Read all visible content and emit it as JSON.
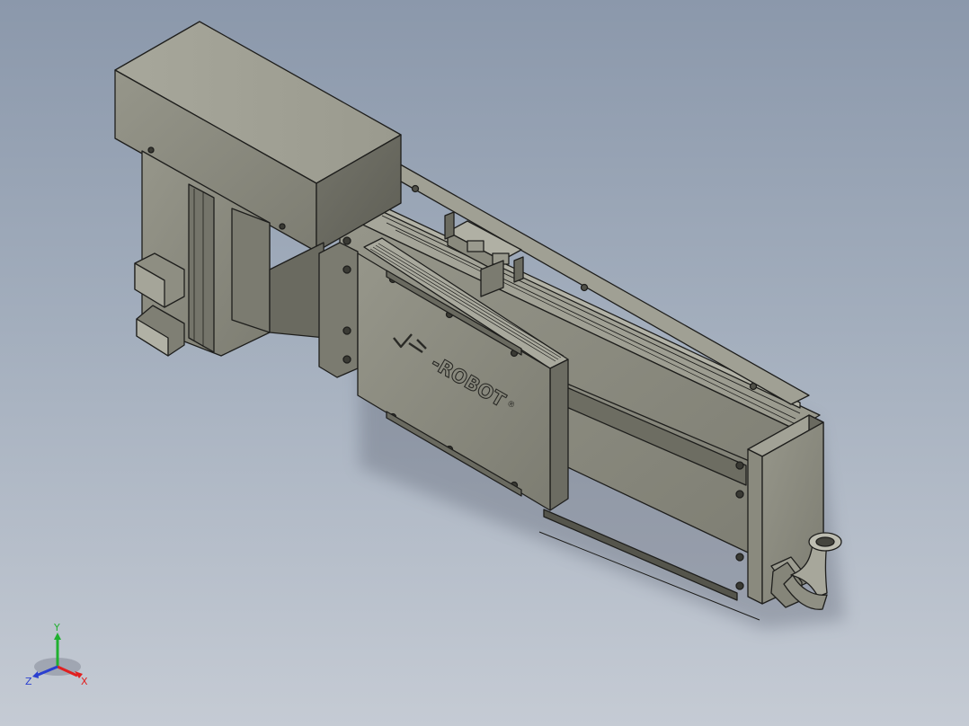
{
  "model": {
    "logo_text": "-ROBOT",
    "registered_mark": "®"
  },
  "triad": {
    "x_label": "X",
    "y_label": "Y",
    "z_label": "Z",
    "x_color": "#e02020",
    "y_color": "#20b030",
    "z_color": "#2a3fd0"
  },
  "colors": {
    "body": "#8c8c80",
    "body_top": "#a3a397",
    "body_dark": "#6e6e63",
    "edge": "#1e1e1c"
  }
}
